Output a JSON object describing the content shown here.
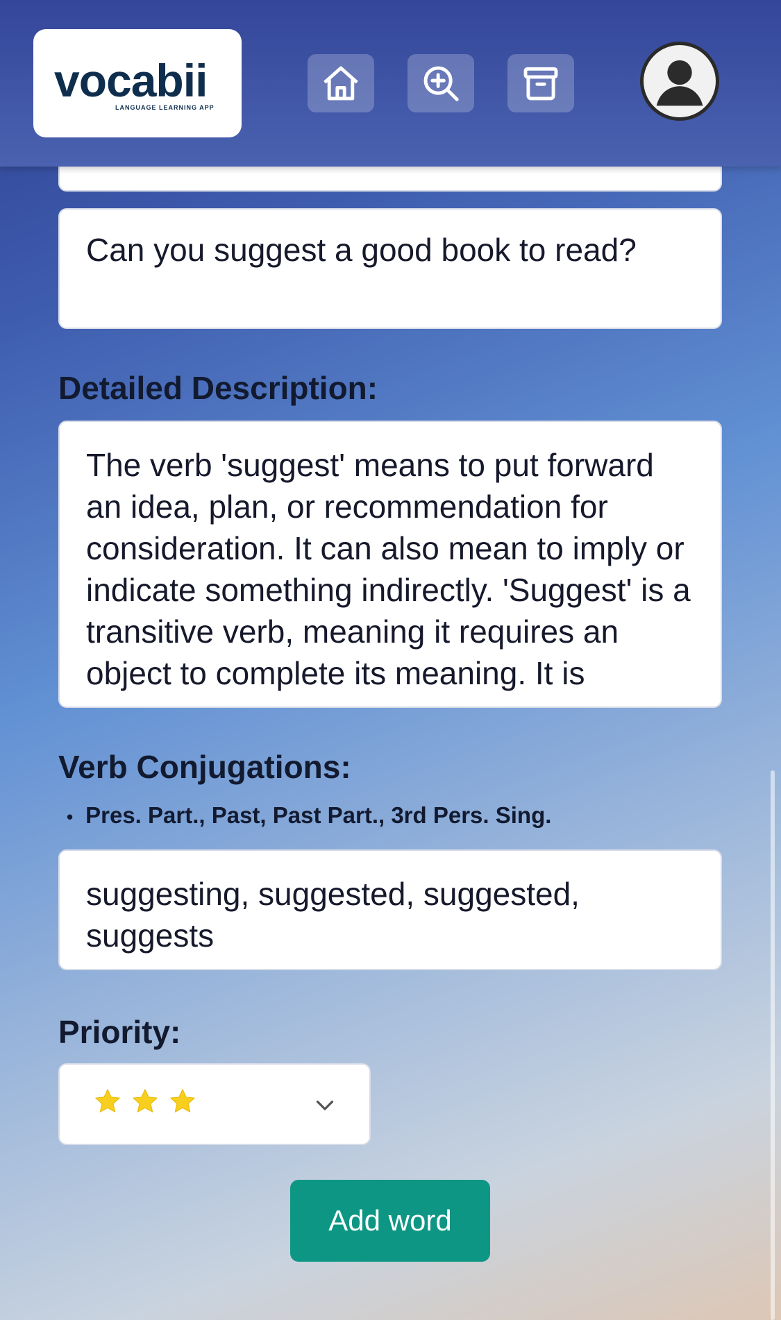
{
  "header": {
    "logo_text": "vocabii",
    "logo_tagline": "LANGUAGE LEARNING APP",
    "nav": [
      {
        "icon": "home-icon"
      },
      {
        "icon": "zoom-in-icon"
      },
      {
        "icon": "archive-icon"
      }
    ],
    "avatar_icon": "user-icon"
  },
  "form": {
    "example_sentence": "Can you suggest a good book to read?",
    "detailed_description_label": "Detailed Description:",
    "detailed_description": "The verb 'suggest' means to put forward an idea, plan, or recommendation for consideration. It can also mean to imply or indicate something indirectly. 'Suggest' is a transitive verb, meaning it requires an object to complete its meaning. It is",
    "verb_conjugations_label": "Verb Conjugations:",
    "conjugation_forms_hint": "Pres. Part., Past, Past Part., 3rd Pers. Sing.",
    "verb_conjugations": "suggesting, suggested, suggested, suggests",
    "priority_label": "Priority:",
    "priority_stars": 3,
    "add_button": "Add word"
  },
  "colors": {
    "accent": "#0e9684",
    "star": "#f9cf1f",
    "header": "#3b4fa2"
  }
}
